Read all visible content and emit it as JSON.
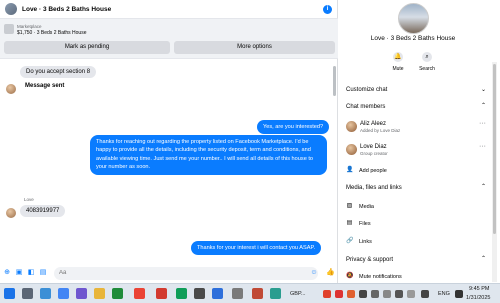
{
  "chat": {
    "header_title": "Love · 3 Beds 2 Baths House",
    "info_icon": "info-icon",
    "marketplace_label": "Marketplace",
    "listing": "$1,750 · 3 Beds 2 Baths House",
    "mark_pending_label": "Mark as pending",
    "more_options_label": "More options"
  },
  "messages": {
    "m1": "Do you accept section 8",
    "m2": "Message sent",
    "m3": "Yes, are you interested?",
    "m4": "Thanks for reaching out regarding the property listed on Facebook Marketplace. I'd be happy to provide all the details, including the security deposit, term and conditions, and available viewing time. Just send me your number.. I will send all details of this house to your number as soon.",
    "sender": "Love",
    "m5": "4083919977",
    "m6": "Thanks for your interest i will contact you ASAP."
  },
  "composer": {
    "placeholder": "Aa"
  },
  "panel": {
    "title": "Love · 3 Beds 2 Baths House",
    "mute_label": "Mute",
    "search_label": "Search",
    "customize_label": "Customize chat",
    "members_label": "Chat members",
    "member1_name": "Aliz Aleez",
    "member1_sub": "Added by Love Diaz",
    "member2_name": "Love Diaz",
    "member2_sub": "Group creator",
    "add_people_label": "Add people",
    "media_section_label": "Media, files and links",
    "media_label": "Media",
    "files_label": "Files",
    "links_label": "Links",
    "privacy_label": "Privacy & support",
    "mute_notifications_label": "Mute notifications"
  },
  "taskbar": {
    "currency": "GBP...",
    "lang": "ENG",
    "time": "9:45 PM",
    "date": "1/31/2025"
  },
  "colors": {
    "accent": "#0a7cff",
    "bubble_in": "#e4e6eb",
    "button_bg": "#d8dadf"
  }
}
